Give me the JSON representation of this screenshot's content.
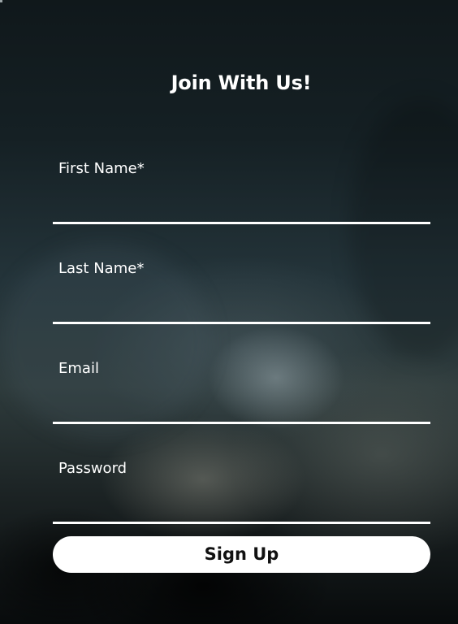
{
  "form": {
    "title": "Join With Us!",
    "fields": [
      {
        "label": "First Name*",
        "value": "",
        "placeholder": ""
      },
      {
        "label": "Last Name*",
        "value": "",
        "placeholder": ""
      },
      {
        "label": "Email",
        "value": "",
        "placeholder": ""
      },
      {
        "label": "Password",
        "value": "",
        "placeholder": ""
      }
    ],
    "submit_label": "Sign Up"
  },
  "colors": {
    "text": "#FFFFFF",
    "button_background": "#FFFFFF",
    "button_text": "#111111",
    "background_dark": "#0B1114"
  }
}
